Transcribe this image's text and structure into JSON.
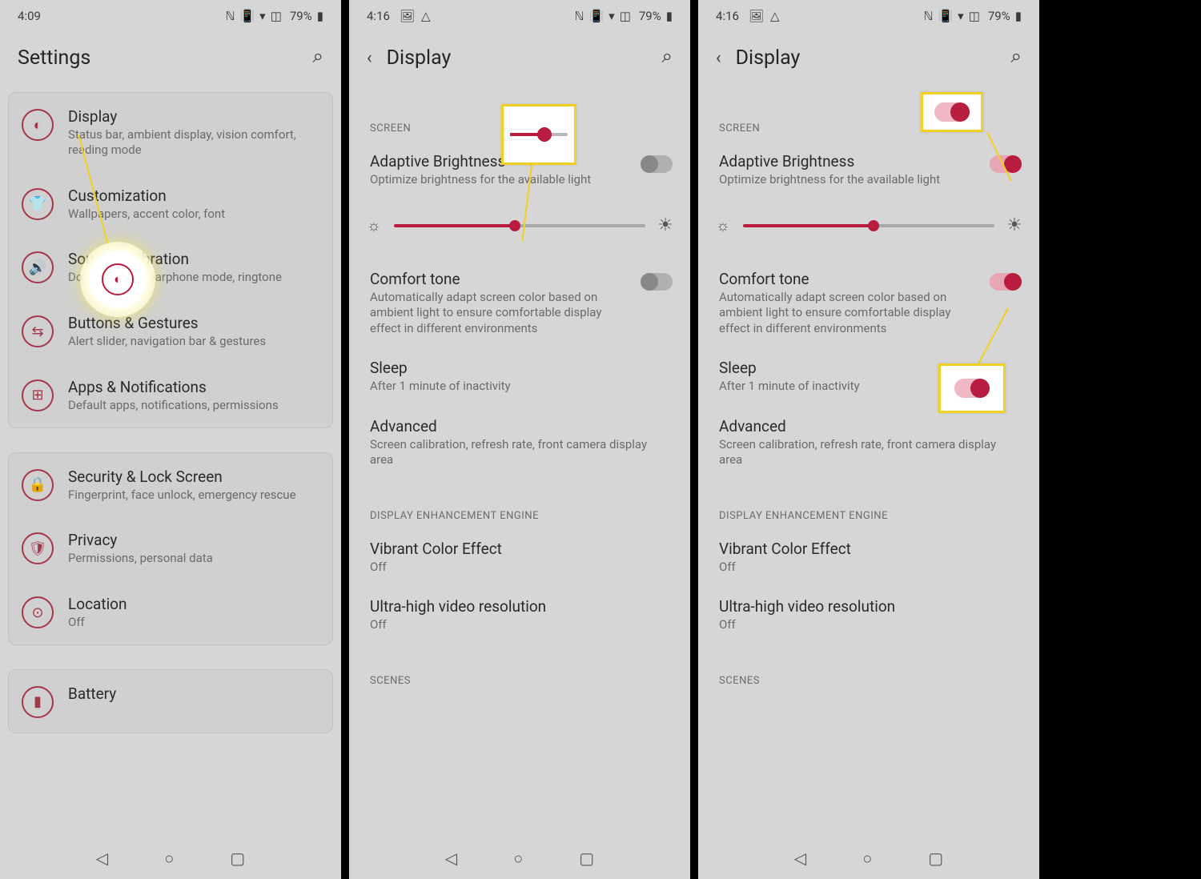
{
  "screens": [
    {
      "time": "4:09",
      "status_icons_left": [],
      "status_icons_right": [
        "ℕ",
        "📳",
        "▾",
        "🛇"
      ],
      "battery": "79%",
      "header_title": "Settings",
      "settings_groups": [
        {
          "items": [
            {
              "icon": "◐",
              "title": "Display",
              "sub": "Status bar, ambient display, vision comfort, reading mode"
            },
            {
              "icon": "👕",
              "title": "Customization",
              "sub": "Wallpapers, accent color, font"
            },
            {
              "icon": "🔊",
              "title": "Sound & Vibration",
              "sub": "Do not disturb, earphone mode, ringtone"
            },
            {
              "icon": "⇆",
              "title": "Buttons & Gestures",
              "sub": "Alert slider, navigation bar & gestures"
            },
            {
              "icon": "⊞",
              "title": "Apps & Notifications",
              "sub": "Default apps, notifications, permissions"
            }
          ]
        },
        {
          "items": [
            {
              "icon": "🔒",
              "title": "Security & Lock Screen",
              "sub": "Fingerprint, face unlock, emergency rescue"
            },
            {
              "icon": "🛡",
              "title": "Privacy",
              "sub": "Permissions, personal data"
            },
            {
              "icon": "⊙",
              "title": "Location",
              "sub": "Off"
            }
          ]
        },
        {
          "items": [
            {
              "icon": "▮",
              "title": "Battery",
              "sub": ""
            }
          ]
        }
      ]
    },
    {
      "time": "4:16",
      "status_icons_left": [
        "🖼",
        "△"
      ],
      "status_icons_right": [
        "ℕ",
        "📳",
        "▾",
        "🛇"
      ],
      "battery": "79%",
      "header_title": "Display",
      "section_screen": "SCREEN",
      "adaptive_title": "Adaptive Brightness",
      "adaptive_sub": "Optimize brightness for the available light",
      "adaptive_on": false,
      "slider_pct": 48,
      "comfort_title": "Comfort tone",
      "comfort_sub": "Automatically adapt screen color based on ambient light to ensure comfortable display effect in different environments",
      "comfort_on": false,
      "sleep_title": "Sleep",
      "sleep_sub": "After 1 minute of inactivity",
      "advanced_title": "Advanced",
      "advanced_sub": "Screen calibration, refresh rate, front camera display area",
      "section_enhance": "DISPLAY ENHANCEMENT ENGINE",
      "vibrant_title": "Vibrant Color Effect",
      "vibrant_sub": "Off",
      "ultra_title": "Ultra-high video resolution",
      "ultra_sub": "Off",
      "section_scenes": "SCENES"
    },
    {
      "time": "4:16",
      "status_icons_left": [
        "🖼",
        "△"
      ],
      "status_icons_right": [
        "ℕ",
        "📳",
        "▾",
        "🛇"
      ],
      "battery": "79%",
      "header_title": "Display",
      "section_screen": "SCREEN",
      "adaptive_title": "Adaptive Brightness",
      "adaptive_sub": "Optimize brightness for the available light",
      "adaptive_on": true,
      "slider_pct": 52,
      "comfort_title": "Comfort tone",
      "comfort_sub": "Automatically adapt screen color based on ambient light to ensure comfortable display effect in different environments",
      "comfort_on": true,
      "sleep_title": "Sleep",
      "sleep_sub": "After 1 minute of inactivity",
      "advanced_title": "Advanced",
      "advanced_sub": "Screen calibration, refresh rate, front camera display area",
      "section_enhance": "DISPLAY ENHANCEMENT ENGINE",
      "vibrant_title": "Vibrant Color Effect",
      "vibrant_sub": "Off",
      "ultra_title": "Ultra-high video resolution",
      "ultra_sub": "Off",
      "section_scenes": "SCENES"
    }
  ]
}
